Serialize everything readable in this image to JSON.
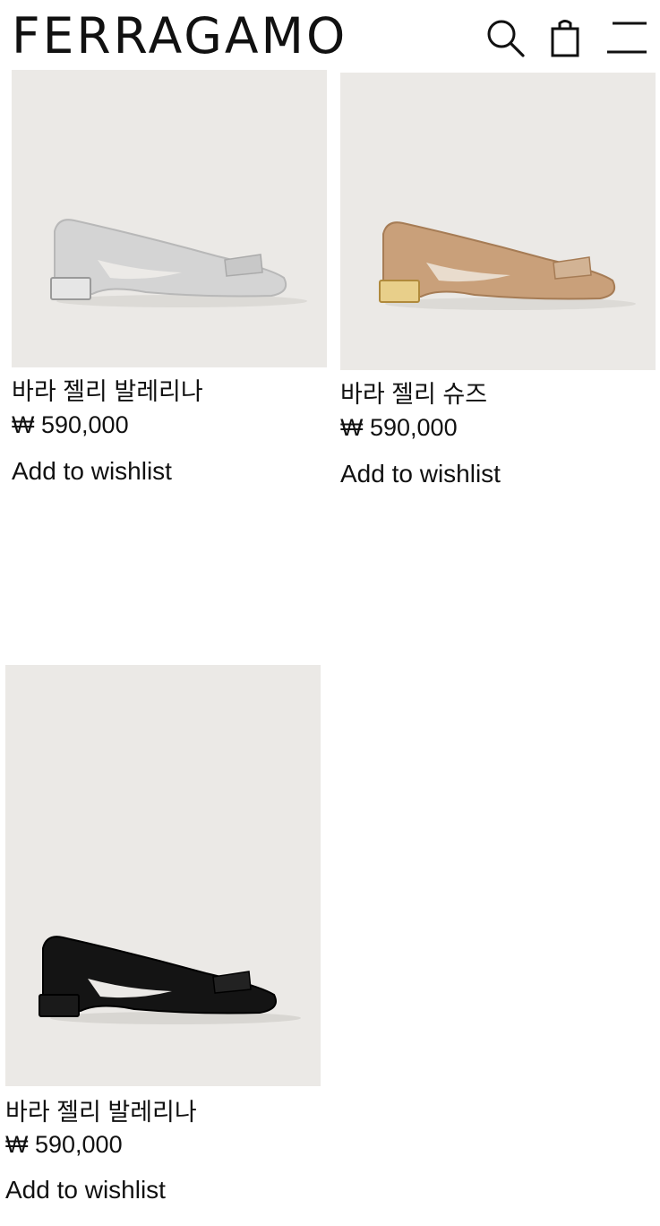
{
  "header": {
    "logo": "FERRAGAMO",
    "icons": [
      "search-icon",
      "shopping-bag-icon",
      "menu-icon"
    ]
  },
  "products": [
    {
      "name": "바라 젤리 발레리나",
      "price": "₩ 590,000",
      "wishlist_label": "Add to wishlist",
      "color": "#cfcfcf",
      "heel": "silver"
    },
    {
      "name": "바라 젤리 슈즈",
      "price": "₩ 590,000",
      "wishlist_label": "Add to wishlist",
      "color": "#c49a6c",
      "heel": "gold"
    },
    {
      "name": "바라 젤리 발레리나",
      "price": "₩ 590,000",
      "wishlist_label": "Add to wishlist",
      "color": "#111111",
      "heel": "black"
    }
  ]
}
